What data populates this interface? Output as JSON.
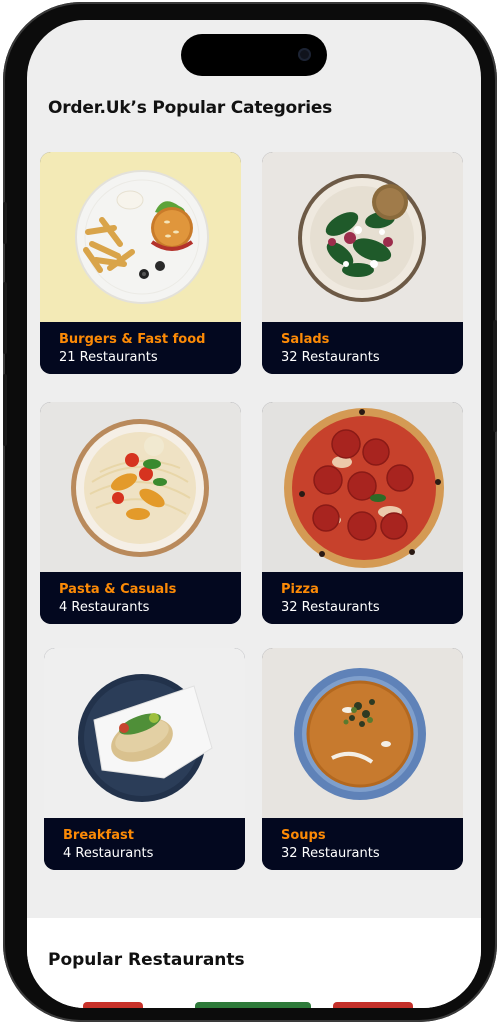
{
  "categories_section": {
    "title": "Order.Uk’s Popular Categories",
    "items": [
      {
        "name": "Burgers & Fast food",
        "count": "21 Restaurants",
        "icon": "burger-plate-image"
      },
      {
        "name": "Salads",
        "count": "32 Restaurants",
        "icon": "salad-bowl-image"
      },
      {
        "name": "Pasta & Casuals",
        "count": "4 Restaurants",
        "icon": "pasta-plate-image"
      },
      {
        "name": "Pizza",
        "count": "32 Restaurants",
        "icon": "pizza-image"
      },
      {
        "name": "Breakfast",
        "count": "4 Restaurants",
        "icon": "breakfast-bagel-image"
      },
      {
        "name": "Soups",
        "count": "32 Restaurants",
        "icon": "soup-bowl-image"
      }
    ]
  },
  "restaurants_section": {
    "title": "Popular Restaurants"
  },
  "colors": {
    "accent": "#fc8a06",
    "card_label_bg": "#03081f",
    "screen_bg": "#eeeeee"
  }
}
